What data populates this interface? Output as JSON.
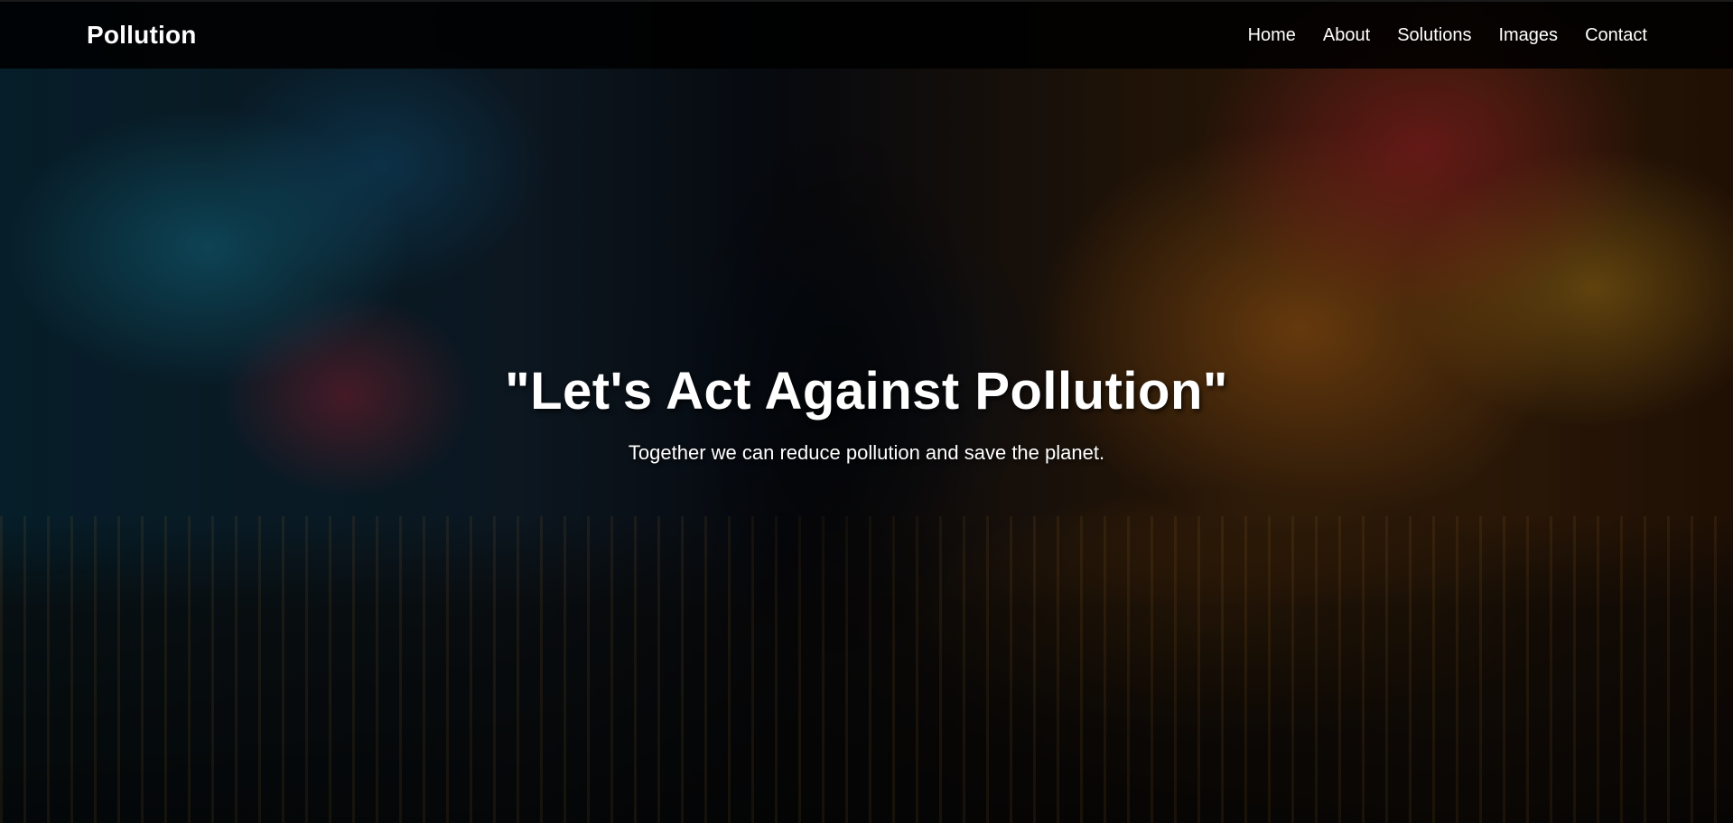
{
  "navbar": {
    "brand": "Pollution",
    "links": [
      {
        "label": "Home"
      },
      {
        "label": "About"
      },
      {
        "label": "Solutions"
      },
      {
        "label": "Images"
      },
      {
        "label": "Contact"
      }
    ]
  },
  "hero": {
    "title": "\"Let's Act Against Pollution\"",
    "subtitle": "Together we can reduce pollution and save the planet."
  },
  "colors": {
    "navbar_bg": "#000000",
    "text": "#ffffff"
  }
}
